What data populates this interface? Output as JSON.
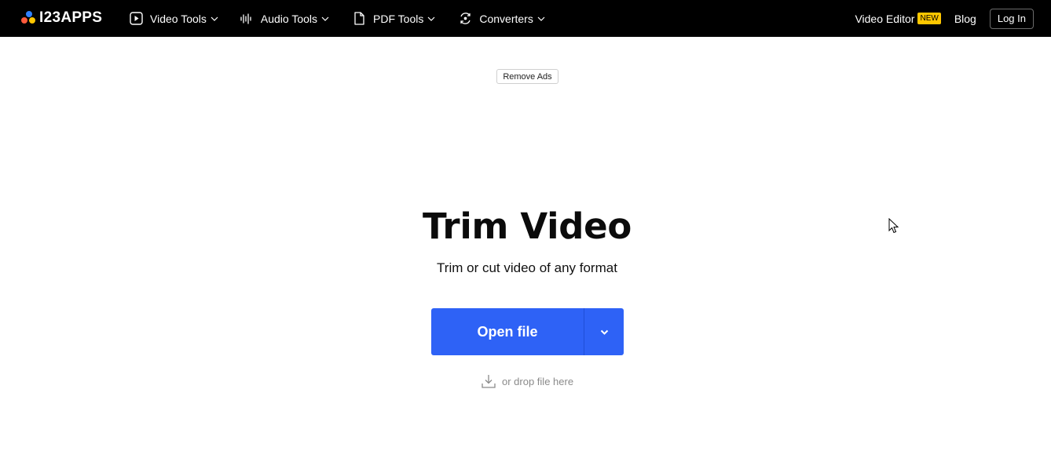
{
  "header": {
    "logo_text": "I23APPS",
    "nav": [
      {
        "label": "Video Tools",
        "icon": "play-icon"
      },
      {
        "label": "Audio Tools",
        "icon": "waveform-icon"
      },
      {
        "label": "PDF Tools",
        "icon": "document-icon"
      },
      {
        "label": "Converters",
        "icon": "convert-icon"
      }
    ],
    "video_editor_label": "Video Editor",
    "new_badge": "NEW",
    "blog_label": "Blog",
    "login_label": "Log In"
  },
  "ads": {
    "remove_label": "Remove Ads"
  },
  "main": {
    "title": "Trim Video",
    "subtitle": "Trim or cut video of any format",
    "open_file_label": "Open file",
    "drop_hint": "or drop file here"
  },
  "colors": {
    "topbar": "#000000",
    "primary": "#2e62f6",
    "badge": "#ffc700"
  }
}
